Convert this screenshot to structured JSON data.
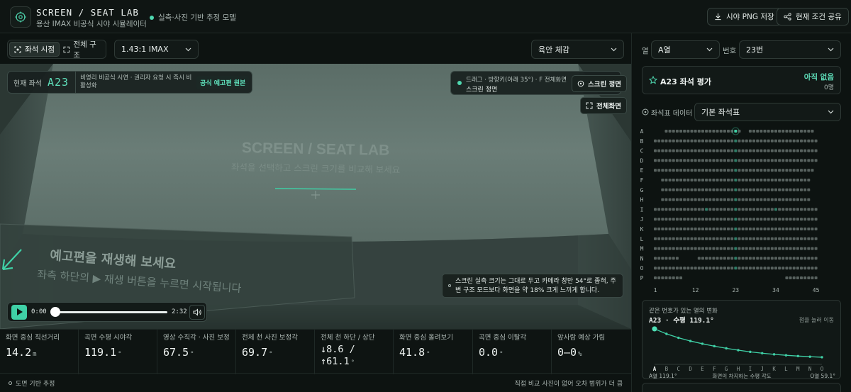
{
  "header": {
    "title": "SCREEN / SEAT LAB",
    "subtitle": "용산 IMAX 비공식 시야 시뮬레이터",
    "model_tag": "실측·사진 기반 추정 모델",
    "save_label": "시야 PNG 저장",
    "share_label": "현재 조건 공유"
  },
  "toolbar": {
    "seat_view_label": "좌석 시점",
    "full_struct_label": "전체 구조",
    "ratio_value": "1.43:1 IMAX",
    "feel_value": "육안 체감"
  },
  "viewer": {
    "screen_title": "SCREEN / SEAT LAB",
    "screen_subtitle": "좌석을 선택하고 스크린 크기를 비교해 보세요",
    "banner_title": "예고편을 재생해 보세요",
    "banner_sub": "좌측 하단의 ▶ 재생 버튼을 누르면 시작됩니다",
    "current_seat_label": "현재 좌석",
    "current_seat_value": "A23",
    "note": "비영리 비공식 시연 · 권리자 요청 시 즉시 비활성화",
    "official_link": "공식 예고편 원본",
    "drag_hint": "드래그 · 방향키(아래 35°) · F 전체화면",
    "drag_state": "스크린  정면",
    "screen_front_btn": "스크린 정면",
    "fullscreen_btn": "전체화면",
    "tip": "스크린 실측 크기는 그대로 두고 카메라 창만 54°로 좁혀, 주변 구조 모드보다 화면을 약 18% 크게 느끼게 합니다.",
    "time_current": "0:00",
    "time_total": "2:32",
    "progress": 0
  },
  "metrics": [
    {
      "label": "화면 중심 직선거리",
      "value": "14.2",
      "unit": "m"
    },
    {
      "label": "곡면 수평 시야각",
      "value": "119.1",
      "unit": "°"
    },
    {
      "label": "영상 수직각 · 사진 보정",
      "value": "67.5",
      "unit": "°"
    },
    {
      "label": "전체 천 사진 보정각",
      "value": "69.7",
      "unit": "°"
    },
    {
      "label": "전체 천 하단 / 상단",
      "value_line1": "↓8.6 /",
      "value_line2": "↑61.1",
      "unit": "°"
    },
    {
      "label": "화면 중심 올려보기",
      "value": "41.8",
      "unit": "°"
    },
    {
      "label": "곡면 중심 이탈각",
      "value": "0.0",
      "unit": "°"
    },
    {
      "label": "앞사람 예상 가림",
      "value": "0–0",
      "unit": "%"
    }
  ],
  "footer": {
    "left": "도면 기반 추정",
    "right": "직접 비교 사진이 없어 오차 범위가 더 큼"
  },
  "right_panel": {
    "row_label": "열",
    "row_value": "A열",
    "number_label": "번호",
    "number_value": "23번",
    "eval_title": "A23 좌석 평가",
    "eval_status": "아직 없음",
    "eval_count": "0명",
    "seat_data_label": "좌석표 데이터",
    "seat_data_value": "기본 좌석표",
    "row_letters": [
      "A",
      "B",
      "C",
      "D",
      "E",
      "F",
      "G",
      "H",
      "I",
      "J",
      "K",
      "L",
      "M",
      "N",
      "O",
      "P"
    ],
    "col_ticks": [
      "1",
      "12",
      "23",
      "34",
      "45"
    ],
    "chart_title": "같은 번호가 있는 열의 변화",
    "chart_value": "A23 · 수평 119.1°",
    "chart_hint": "점을 눌러 이동",
    "chart_left": "A열 119.1°",
    "chart_mid": "화면이 차지하는 수평 각도",
    "chart_right": "O열 59.1°"
  },
  "chart_data": {
    "type": "line",
    "title": "같은 번호가 있는 열의 변화",
    "subtitle": "A23 · 수평 119.1°",
    "xlabel": "",
    "ylabel": "화면이 차지하는 수평 각도",
    "categories": [
      "A",
      "B",
      "C",
      "D",
      "E",
      "F",
      "G",
      "H",
      "I",
      "J",
      "K",
      "L",
      "M",
      "N",
      "O"
    ],
    "series": [
      {
        "values": [
          119.1,
          108.5,
          100.2,
          93.4,
          87.6,
          82.5,
          78.0,
          74.0,
          70.5,
          67.6,
          65.2,
          63.2,
          61.5,
          60.2,
          59.1
        ]
      }
    ],
    "selected": "A",
    "grid": false,
    "ylim": [
      50,
      125
    ]
  },
  "colors": {
    "accent": "#3fd0a6",
    "background": "#0d1311",
    "screen": "#5f726c"
  }
}
